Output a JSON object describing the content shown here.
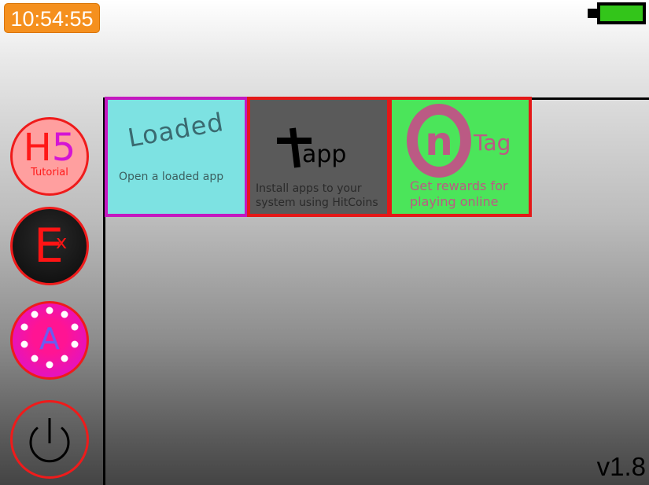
{
  "status_bar": {
    "clock": "10:54:55",
    "battery_level": 1.0,
    "battery_color": "#33c51a"
  },
  "sidebar": {
    "items": [
      {
        "id": "h5-tutorial",
        "letter": "H",
        "digit": "5",
        "sublabel": "Tutorial"
      },
      {
        "id": "ex",
        "letter": "E",
        "superscript": "x"
      },
      {
        "id": "a-app",
        "letter": "A",
        "icon": "dotted-circle-a-icon"
      },
      {
        "id": "power",
        "icon": "power-icon"
      }
    ]
  },
  "tiles": [
    {
      "id": "loaded",
      "title": "Loaded",
      "description": "Open a loaded app",
      "bg": "#7de2e2",
      "border": "#c418bf"
    },
    {
      "id": "add-app",
      "title": "app",
      "icon": "plus-icon",
      "description_line1": "Install apps to your",
      "description_line2": "system using HitCoins",
      "bg": "#5a5a5a",
      "border": "#e41818"
    },
    {
      "id": "ontag",
      "logo_letters": "n",
      "title": "Tag",
      "description_line1": "Get rewards for",
      "description_line2": "playing online",
      "bg": "#4be55a",
      "border": "#e41818"
    }
  ],
  "version": "v1.8"
}
